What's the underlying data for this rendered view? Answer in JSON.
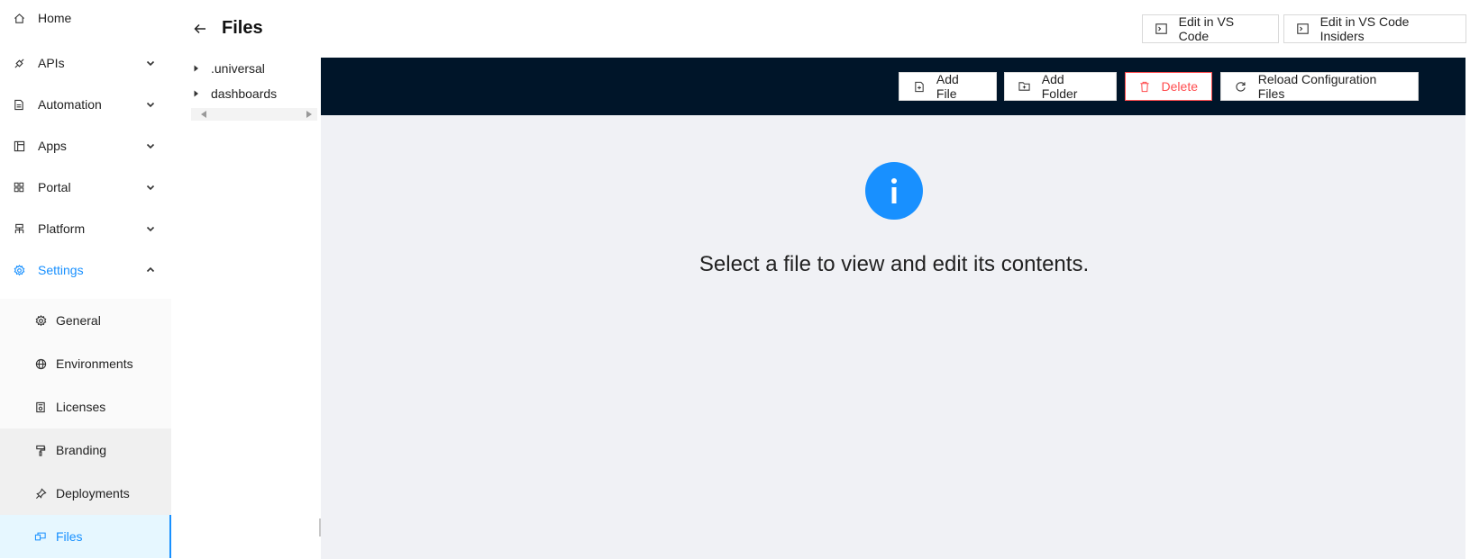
{
  "sidebar": {
    "items": [
      {
        "label": "Home",
        "icon": "home-icon",
        "chevron": "none"
      },
      {
        "label": "APIs",
        "icon": "api-icon",
        "chevron": "down"
      },
      {
        "label": "Automation",
        "icon": "file-icon",
        "chevron": "down"
      },
      {
        "label": "Apps",
        "icon": "layout-icon",
        "chevron": "down"
      },
      {
        "label": "Portal",
        "icon": "grid-icon",
        "chevron": "down"
      },
      {
        "label": "Platform",
        "icon": "cluster-icon",
        "chevron": "down"
      },
      {
        "label": "Settings",
        "icon": "gear-icon",
        "chevron": "up",
        "active": true
      }
    ],
    "settings_children": [
      {
        "label": "General",
        "icon": "gear-icon"
      },
      {
        "label": "Environments",
        "icon": "globe-icon"
      },
      {
        "label": "Licenses",
        "icon": "license-icon"
      },
      {
        "label": "Branding",
        "icon": "paint-roller-icon"
      },
      {
        "label": "Deployments",
        "icon": "pin-icon"
      },
      {
        "label": "Files",
        "icon": "files-icon",
        "active": true
      }
    ]
  },
  "header": {
    "title": "Files",
    "edit_vscode_label": "Edit in VS Code",
    "edit_vscode_insiders_label": "Edit in VS Code Insiders"
  },
  "tree": {
    "nodes": [
      ".universal",
      "dashboards"
    ]
  },
  "toolbar": {
    "add_file_label": "Add File",
    "add_folder_label": "Add Folder",
    "delete_label": "Delete",
    "reload_label": "Reload Configuration Files"
  },
  "content": {
    "empty_message": "Select a file to view and edit its contents.",
    "icon": "info-icon"
  },
  "colors": {
    "accent": "#1890ff",
    "toolbar_bg": "#001529",
    "danger": "#ff4d4f",
    "content_bg": "#f0f1f5"
  }
}
